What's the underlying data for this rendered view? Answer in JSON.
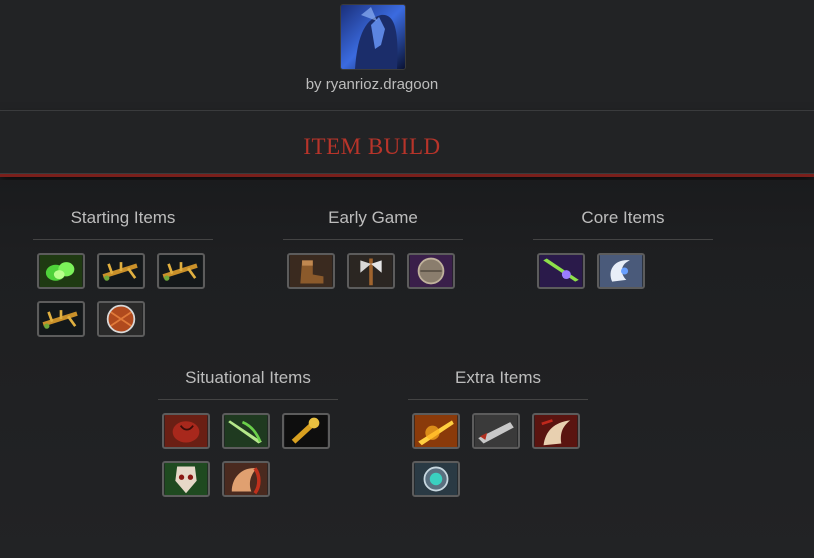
{
  "author": {
    "byline": "by ryanrioz.dragoon",
    "avatar_icon": "hero-portrait-icon"
  },
  "banner": {
    "title": "ITEM BUILD"
  },
  "sections": [
    {
      "title": "Starting Items",
      "items": [
        "tango-icon",
        "iron-branch-icon",
        "iron-branch-icon",
        "iron-branch-icon",
        "stout-shield-icon"
      ]
    },
    {
      "title": "Early Game",
      "items": [
        "power-treads-icon",
        "battle-fury-axe-icon",
        "vanguard-icon"
      ]
    },
    {
      "title": "Core Items",
      "items": [
        "yasha-blade-icon",
        "diffusal-blade-icon"
      ]
    },
    {
      "title": "Situational Items",
      "items": [
        "heart-icon",
        "butterfly-icon",
        "skull-basher-icon",
        "satanic-icon",
        "abyssal-blade-icon"
      ]
    },
    {
      "title": "Extra Items",
      "items": [
        "radiance-icon",
        "daedalus-icon",
        "desolator-icon",
        "skadi-icon"
      ]
    }
  ]
}
